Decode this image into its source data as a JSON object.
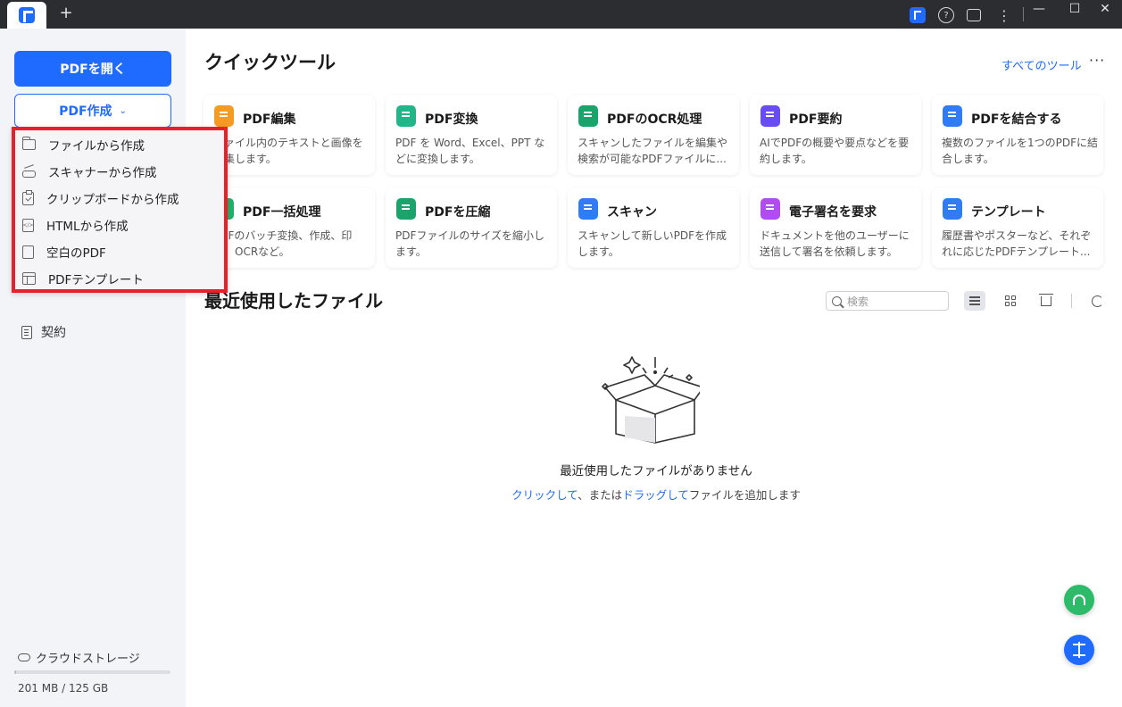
{
  "titlebar": {
    "new_tab": "+",
    "help": "?",
    "more": "⋮",
    "minimize": "—",
    "maximize": "☐",
    "close": "✕"
  },
  "sidebar": {
    "open_pdf": "PDFを開く",
    "create_pdf": "PDF作成",
    "contract": "契約",
    "cloud_storage": "クラウドストレージ",
    "storage_usage": "201 MB / 125 GB",
    "storage_fraction": 0.0016
  },
  "dropdown": {
    "items": [
      {
        "label": "ファイルから作成",
        "icon": "folder-icon"
      },
      {
        "label": "スキャナーから作成",
        "icon": "scanner-icon"
      },
      {
        "label": "クリップボードから作成",
        "icon": "clipboard-icon"
      },
      {
        "label": "HTMLから作成",
        "icon": "html-file-icon"
      },
      {
        "label": "空白のPDF",
        "icon": "blank-file-icon"
      },
      {
        "label": "PDFテンプレート",
        "icon": "template-icon"
      }
    ]
  },
  "main": {
    "quick_tools_title": "クイックツール",
    "all_tools_link": "すべてのツール",
    "more": "···",
    "tools": [
      {
        "name": "PDF編集",
        "desc": "ファイル内のテキストと画像を編集します。",
        "color": "#f59a23"
      },
      {
        "name": "PDF変換",
        "desc": "PDF を Word、Excel、PPT などに変換します。",
        "color": "#22b58a"
      },
      {
        "name": "PDFのOCR処理",
        "desc": "スキャンしたファイルを編集や検索が可能なPDFファイルに...",
        "color": "#1aa36b"
      },
      {
        "name": "PDF要約",
        "desc": "AIでPDFの概要や要点などを要約します。",
        "color": "#6a4cf5"
      },
      {
        "name": "PDFを結合する",
        "desc": "複数のファイルを1つのPDFに結合します。",
        "color": "#2f7cf6"
      },
      {
        "name": "PDF一括処理",
        "desc": "PDFのバッチ変換、作成、印刷、OCRなど。",
        "color": "#22b06a"
      },
      {
        "name": "PDFを圧縮",
        "desc": "PDFファイルのサイズを縮小します。",
        "color": "#1aa36b"
      },
      {
        "name": "スキャン",
        "desc": "スキャンして新しいPDFを作成します。",
        "color": "#2f7cf6"
      },
      {
        "name": "電子署名を要求",
        "desc": "ドキュメントを他のユーザーに送信して署名を依頼します。",
        "color": "#b04cf0"
      },
      {
        "name": "テンプレート",
        "desc": "履歴書やポスターなど、それぞれに応じたPDFテンプレート...",
        "color": "#2f7cf6"
      }
    ],
    "recent_title": "最近使用したファイル",
    "search_placeholder": "検索",
    "empty_message": "最近使用したファイルがありません",
    "hint_click": "クリックして",
    "hint_mid": "、または",
    "hint_drag": "ドラッグして",
    "hint_end": "ファイルを追加します"
  }
}
